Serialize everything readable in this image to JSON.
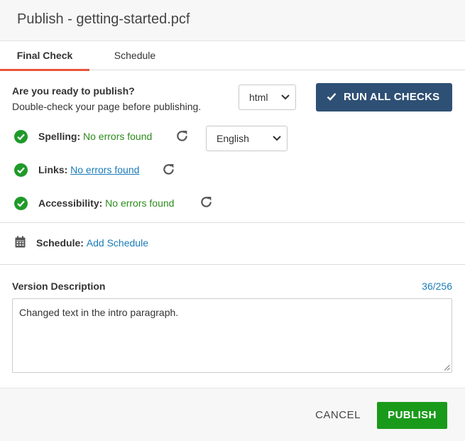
{
  "dialog": {
    "title": "Publish - getting-started.pcf"
  },
  "tabs": [
    {
      "label": "Final Check",
      "active": true
    },
    {
      "label": "Schedule",
      "active": false
    }
  ],
  "final_check": {
    "heading": "Are you ready to publish?",
    "subheading": "Double-check your page before publishing.",
    "format_select": {
      "selected": "html"
    },
    "run_all_button": {
      "label": "RUN ALL CHECKS",
      "icon": "check-icon"
    },
    "checks": [
      {
        "label": "Spelling:",
        "status": "No errors found",
        "icon": "check-circle-icon",
        "refresh_icon": "refresh-icon"
      },
      {
        "label": "Links:",
        "status": "No errors found",
        "icon": "check-circle-icon",
        "refresh_icon": "refresh-icon"
      },
      {
        "label": "Accessibility:",
        "status": "No errors found",
        "icon": "check-circle-icon",
        "refresh_icon": "refresh-icon"
      }
    ],
    "language_select": {
      "selected": "English"
    }
  },
  "schedule": {
    "label": "Schedule:",
    "link": "Add Schedule",
    "icon": "calendar-icon"
  },
  "version_description": {
    "label": "Version Description",
    "count": "36/256",
    "value": "Changed text in the intro paragraph."
  },
  "footer": {
    "cancel_label": "CANCEL",
    "publish_label": "PUBLISH"
  },
  "colors": {
    "accent_tab": "#e8553a",
    "primary_button": "#2f5075",
    "publish_button": "#1a9a1a",
    "success_text": "#2a8a1a",
    "link": "#1a7bb8"
  }
}
